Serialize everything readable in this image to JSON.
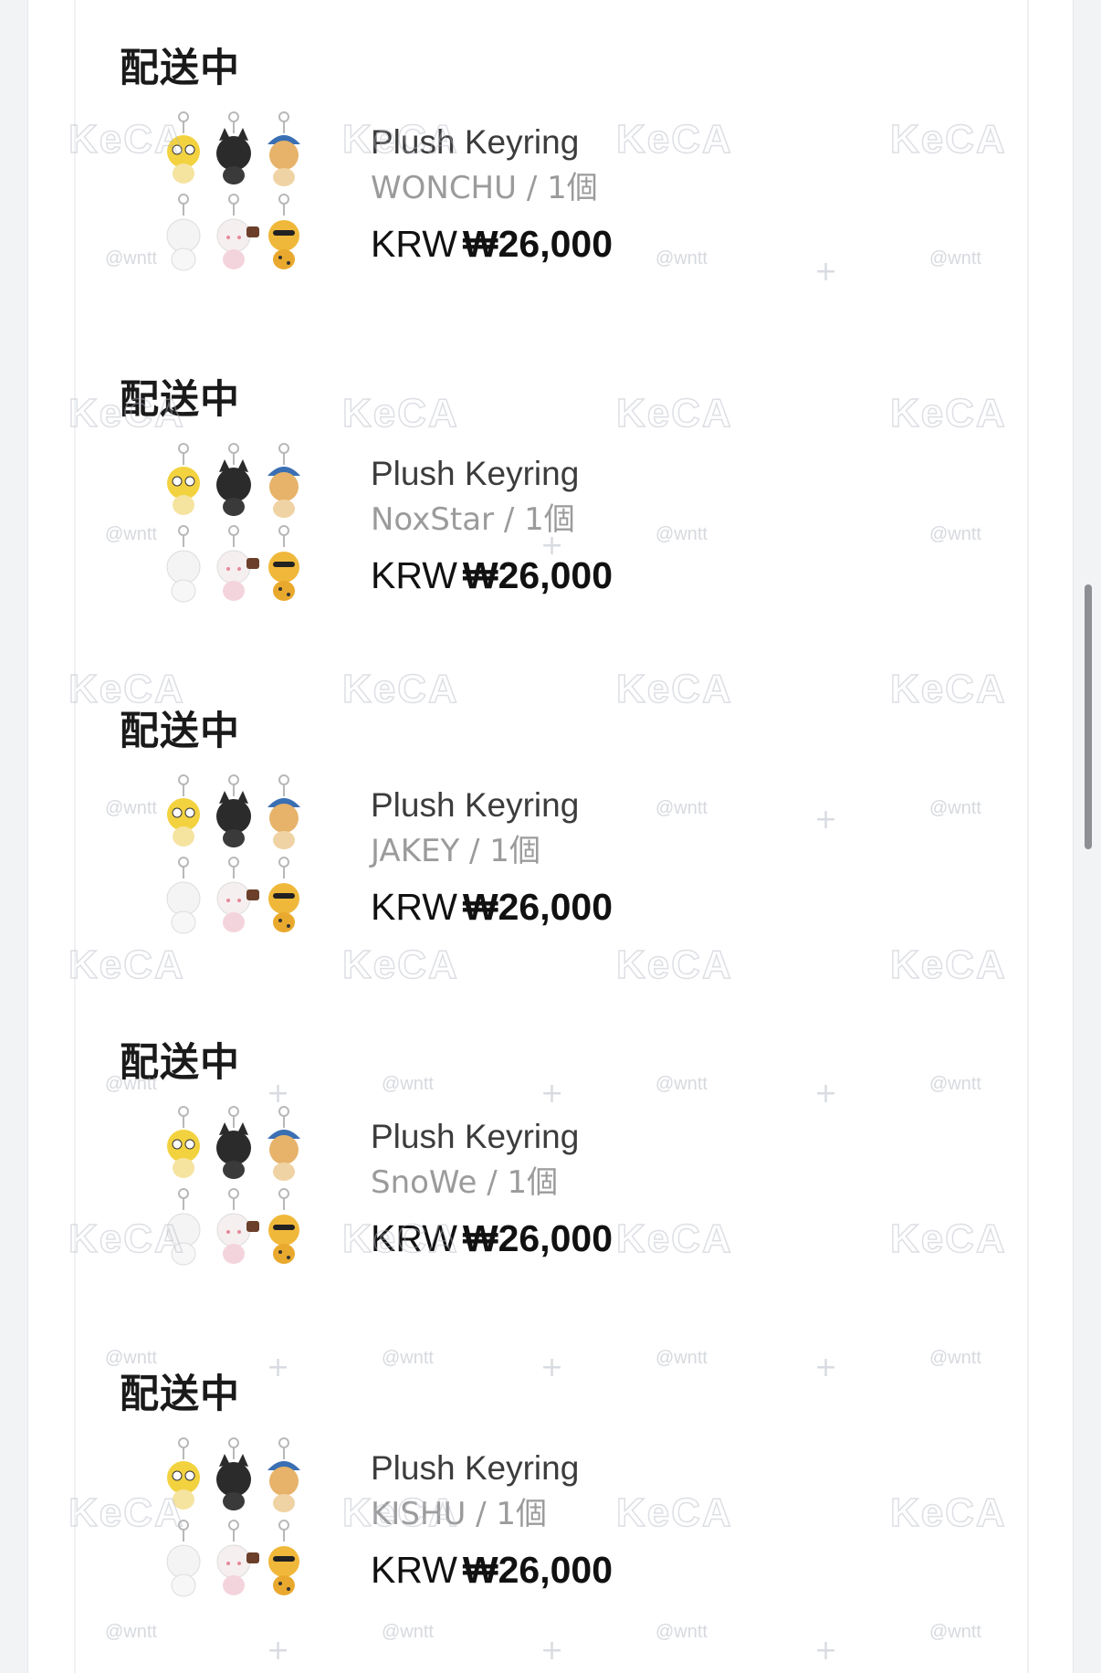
{
  "orders": [
    {
      "status": "配送中",
      "product": "Plush Keyring",
      "option": "WONCHU / 1個",
      "currency": "KRW",
      "amount": "₩26,000"
    },
    {
      "status": "配送中",
      "product": "Plush Keyring",
      "option": "NoxStar / 1個",
      "currency": "KRW",
      "amount": "₩26,000"
    },
    {
      "status": "配送中",
      "product": "Plush Keyring",
      "option": "JAKEY / 1個",
      "currency": "KRW",
      "amount": "₩26,000"
    },
    {
      "status": "配送中",
      "product": "Plush Keyring",
      "option": "SnoWe / 1個",
      "currency": "KRW",
      "amount": "₩26,000"
    },
    {
      "status": "配送中",
      "product": "Plush Keyring",
      "option": "KISHU / 1個",
      "currency": "KRW",
      "amount": "₩26,000"
    }
  ],
  "watermark": {
    "brand": "KeCA",
    "handle": "@wntt"
  },
  "colors": {
    "status_text": "#1a1a1a",
    "product_text": "#3c3c3c",
    "option_text": "#9b9b9b",
    "price_text": "#111111"
  }
}
